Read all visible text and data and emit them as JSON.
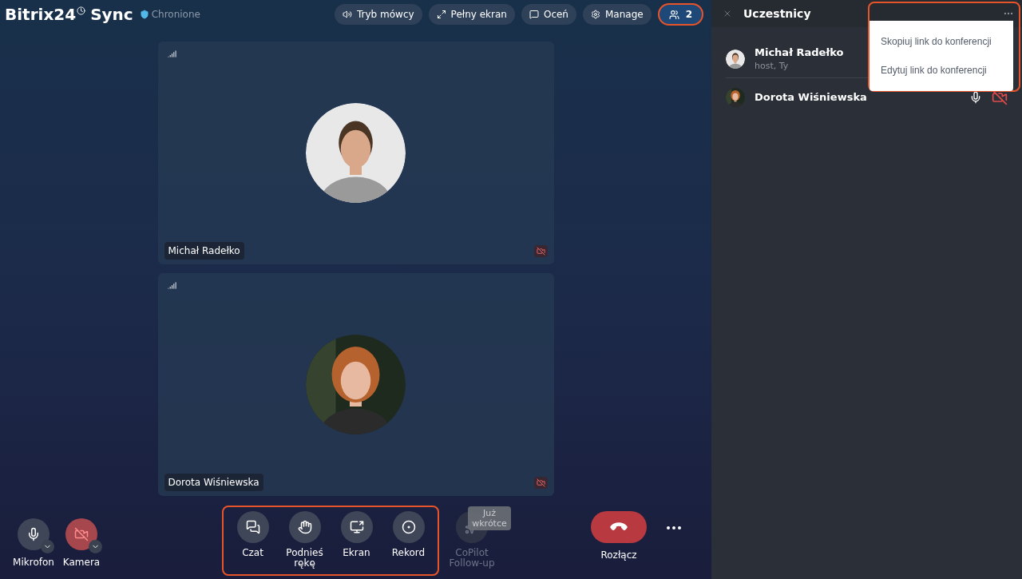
{
  "app": {
    "logo": "Bitrix24",
    "logo_suffix": "Sync",
    "org": "Chronione"
  },
  "top_buttons": [
    {
      "kind": "speaker",
      "label": "Tryb mówcy"
    },
    {
      "kind": "fullscreen",
      "label": "Pełny ekran"
    },
    {
      "kind": "rate",
      "label": "Oceń"
    },
    {
      "kind": "manage",
      "label": "Manage"
    }
  ],
  "participants_button": {
    "count": "2",
    "selected": true
  },
  "tiles": [
    {
      "name": "Michał Radełko",
      "camera_off": true,
      "kind": "man"
    },
    {
      "name": "Dorota Wiśniewska",
      "camera_off": true,
      "kind": "woman"
    }
  ],
  "controls": [
    {
      "kind": "mic",
      "label": "Mikrofon",
      "off": false
    },
    {
      "kind": "camera",
      "label": "Kamera",
      "off": true
    }
  ],
  "actions": [
    {
      "kind": "chat",
      "label": "Czat"
    },
    {
      "kind": "hand",
      "label": "Podnieś rękę"
    },
    {
      "kind": "screen",
      "label": "Ekran"
    },
    {
      "kind": "record",
      "label": "Rekord"
    }
  ],
  "copilot": {
    "label": "CoPilot Follow-up",
    "badge": "Już wkrótce",
    "disabled": true
  },
  "hangup": {
    "label": "Rozłącz"
  },
  "sidebar": {
    "title": "Uczestnicy",
    "participants": [
      {
        "name": "Michał Radełko",
        "role": "host, Ty",
        "kind": "man"
      },
      {
        "name": "Dorota Wiśniewska",
        "kind": "woman",
        "mic": true,
        "camera_off": true
      }
    ]
  },
  "menu": {
    "items": [
      "Skopiuj link do konferencji",
      "Edytuj link do konferencji"
    ]
  }
}
